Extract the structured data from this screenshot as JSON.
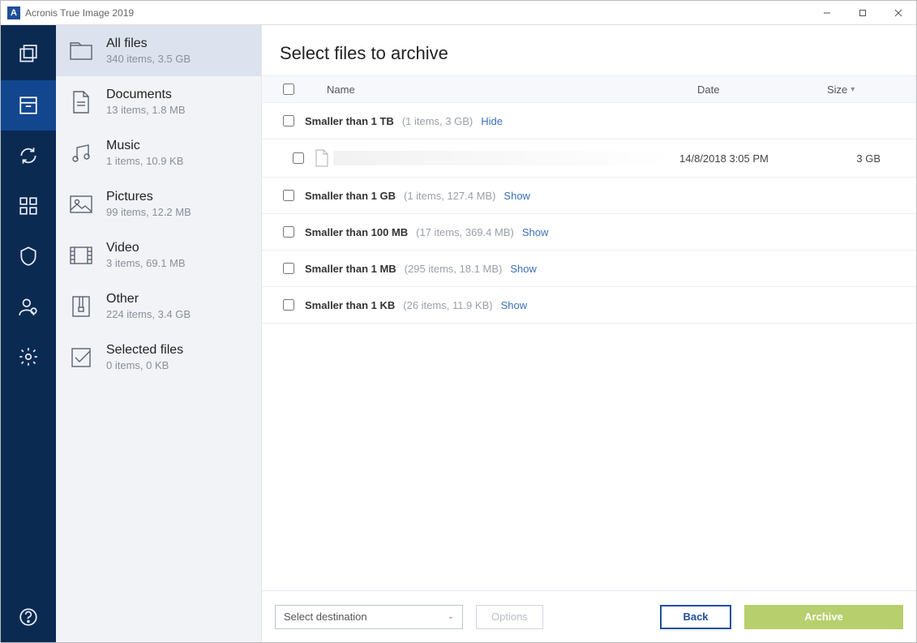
{
  "window": {
    "title": "Acronis True Image 2019",
    "appicon_letter": "A"
  },
  "categories": [
    {
      "key": "all",
      "name": "All files",
      "sub": "340 items, 3.5 GB",
      "selected": true
    },
    {
      "key": "documents",
      "name": "Documents",
      "sub": "13 items, 1.8 MB",
      "selected": false
    },
    {
      "key": "music",
      "name": "Music",
      "sub": "1 items, 10.9 KB",
      "selected": false
    },
    {
      "key": "pictures",
      "name": "Pictures",
      "sub": "99 items, 12.2 MB",
      "selected": false
    },
    {
      "key": "video",
      "name": "Video",
      "sub": "3 items, 69.1 MB",
      "selected": false
    },
    {
      "key": "other",
      "name": "Other",
      "sub": "224 items, 3.4 GB",
      "selected": false
    },
    {
      "key": "selected",
      "name": "Selected files",
      "sub": "0 items, 0 KB",
      "selected": false
    }
  ],
  "main": {
    "title": "Select files to archive",
    "columns": {
      "name": "Name",
      "date": "Date",
      "size": "Size"
    }
  },
  "groups": [
    {
      "name": "Smaller than 1 TB",
      "info": "(1 items, 3 GB)",
      "toggle": "Hide",
      "rows": [
        {
          "name": "",
          "date": "14/8/2018 3:05 PM",
          "size": "3 GB"
        }
      ]
    },
    {
      "name": "Smaller than 1 GB",
      "info": "(1 items, 127.4 MB)",
      "toggle": "Show",
      "rows": []
    },
    {
      "name": "Smaller than 100 MB",
      "info": "(17 items, 369.4 MB)",
      "toggle": "Show",
      "rows": []
    },
    {
      "name": "Smaller than 1 MB",
      "info": "(295 items, 18.1 MB)",
      "toggle": "Show",
      "rows": []
    },
    {
      "name": "Smaller than 1 KB",
      "info": "(26 items, 11.9 KB)",
      "toggle": "Show",
      "rows": []
    }
  ],
  "footer": {
    "destination_placeholder": "Select destination",
    "options": "Options",
    "back": "Back",
    "archive": "Archive"
  }
}
